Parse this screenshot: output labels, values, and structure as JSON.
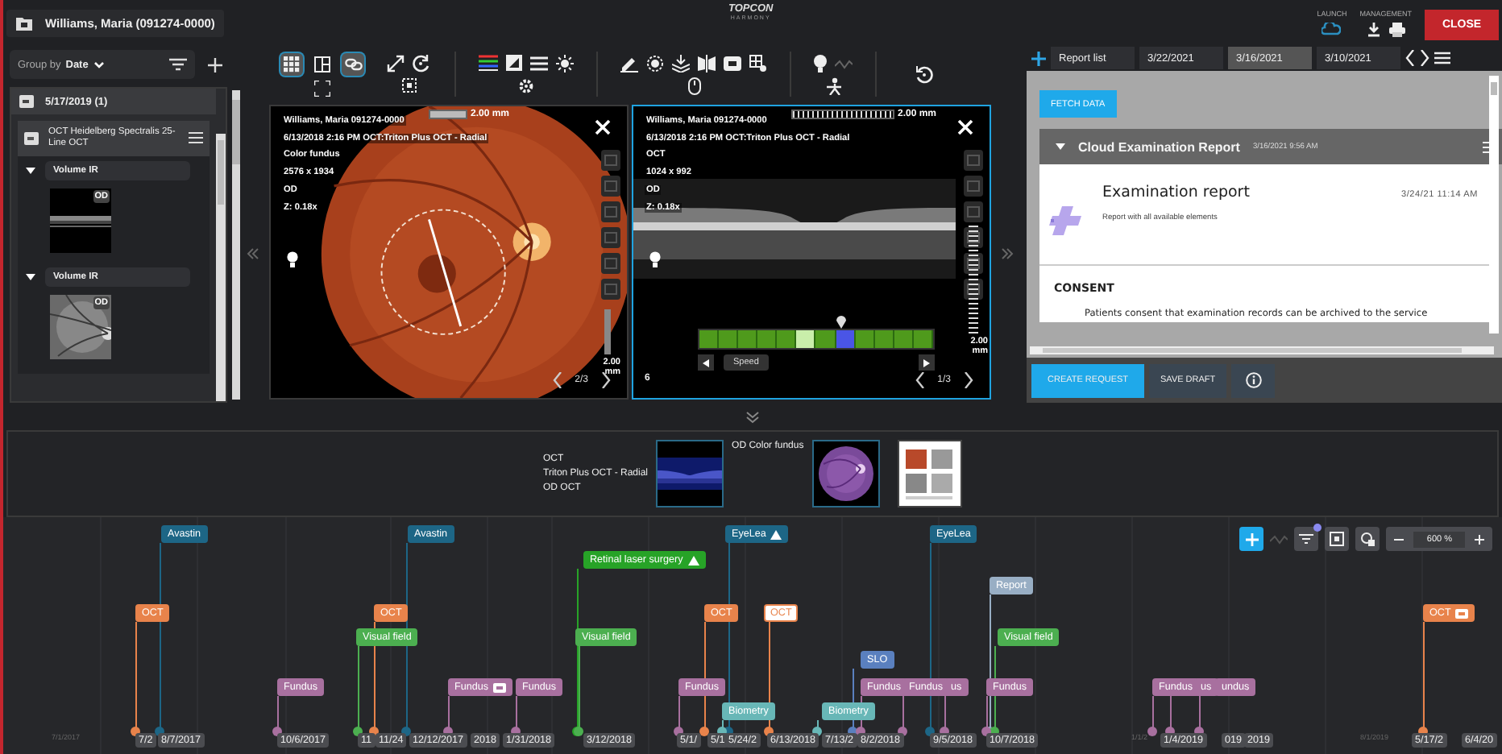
{
  "patient": {
    "name": "Williams, Maria (091274-0000)"
  },
  "brand": {
    "name": "TOPCON",
    "sub": "HARMONY"
  },
  "top_actions": [
    {
      "label": "LAUNCH"
    },
    {
      "label": "MANAGEMENT"
    }
  ],
  "close_button": "CLOSE",
  "sidebar": {
    "group_by_label": "Group by",
    "group_by_value": "Date",
    "groups": [
      {
        "date": "5/17/2019 (1)",
        "items": [
          {
            "title": "OCT Heidelberg Spectralis 25-Line OCT",
            "series": [
              {
                "name": "Volume IR",
                "expanded": true,
                "eye": "OD",
                "kind": "bscan"
              },
              {
                "name": "Volume IR",
                "expanded": true,
                "eye": "OD",
                "kind": "fundus"
              }
            ]
          }
        ]
      }
    ]
  },
  "toolbar": {
    "view_modes": [
      {
        "selected": true
      },
      {
        "selected": false
      },
      {
        "selected": true
      }
    ]
  },
  "viewers": [
    {
      "kind": "fundus",
      "selected": false,
      "scale": "2.00 mm",
      "side_scale": "2.00 mm",
      "info": [
        "Williams, Maria 091274-0000",
        "6/13/2018 2:16 PM OCT:Triton Plus OCT - Radial",
        "Color fundus",
        "2576 x 1934",
        "OD",
        "Z: 0.18x"
      ],
      "page": "2/3"
    },
    {
      "kind": "oct",
      "selected": true,
      "scale": "2.00 mm",
      "side_scale": "2.00 mm",
      "info": [
        "Williams, Maria 091274-0000",
        "6/13/2018 2:16 PM OCT:Triton Plus OCT - Radial",
        "OCT",
        "1024 x 992",
        "OD",
        "Z: 0.18x"
      ],
      "page": "1/3",
      "index": "6",
      "speed_label": "Speed",
      "slices": [
        {
          "selected": false,
          "marked": false
        },
        {
          "selected": false,
          "marked": false
        },
        {
          "selected": false,
          "marked": false
        },
        {
          "selected": false,
          "marked": false
        },
        {
          "selected": false,
          "marked": false
        },
        {
          "selected": false,
          "marked": true
        },
        {
          "selected": false,
          "marked": false
        },
        {
          "selected": true,
          "marked": false
        },
        {
          "selected": false,
          "marked": false
        },
        {
          "selected": false,
          "marked": false
        },
        {
          "selected": false,
          "marked": false
        },
        {
          "selected": false,
          "marked": false
        }
      ]
    }
  ],
  "report": {
    "tabs": [
      {
        "label": "Report list",
        "selected": false
      },
      {
        "label": "3/22/2021",
        "selected": false
      },
      {
        "label": "3/16/2021",
        "selected": true
      },
      {
        "label": "3/10/2021",
        "selected": false
      }
    ],
    "fetch_button": "FETCH DATA",
    "section": {
      "title": "Cloud Examination Report",
      "date": "3/16/2021 9:56 AM",
      "expanded": true
    },
    "doc": {
      "title": "Examination report",
      "date": "3/24/21 11:14 AM",
      "subtitle": "Report with all available elements",
      "heading": "CONSENT",
      "text": "Patients consent that examination records can be archived to the service"
    },
    "buttons": [
      {
        "label": "CREATE REQUEST",
        "kind": "primary"
      },
      {
        "label": "SAVE DRAFT",
        "kind": "secondary"
      }
    ]
  },
  "strip": {
    "lines": [
      "OCT",
      "Triton Plus OCT - Radial",
      "OD OCT"
    ],
    "fundus_label": "OD Color fundus"
  },
  "timeline": {
    "zoom": "600 %",
    "axis_ticks": [
      "7/1/2017",
      "1/1/2",
      "8/1/2019"
    ],
    "events": [
      {
        "label": "Avastin",
        "kind": "medication",
        "warning": false,
        "attachment": false,
        "selected": false
      },
      {
        "label": "Avastin",
        "kind": "medication",
        "warning": false,
        "attachment": false,
        "selected": false
      },
      {
        "label": "EyeLea",
        "kind": "medication",
        "warning": true,
        "attachment": false,
        "selected": false
      },
      {
        "label": "EyeLea",
        "kind": "medication",
        "warning": false,
        "attachment": false,
        "selected": false
      },
      {
        "label": "Retinal laser surgery",
        "kind": "procedure",
        "warning": true,
        "attachment": false,
        "selected": false
      },
      {
        "label": "Report",
        "kind": "report",
        "warning": false,
        "attachment": false,
        "selected": false
      },
      {
        "label": "OCT",
        "kind": "oct",
        "warning": false,
        "attachment": false,
        "selected": false
      },
      {
        "label": "OCT",
        "kind": "oct",
        "warning": false,
        "attachment": false,
        "selected": false
      },
      {
        "label": "OCT",
        "kind": "oct",
        "warning": false,
        "attachment": false,
        "selected": false
      },
      {
        "label": "OCT",
        "kind": "oct",
        "warning": false,
        "attachment": false,
        "selected": true
      },
      {
        "label": "OCT",
        "kind": "oct",
        "warning": false,
        "attachment": true,
        "selected": false
      },
      {
        "label": "Visual field",
        "kind": "visual-field",
        "warning": false,
        "attachment": false,
        "selected": false
      },
      {
        "label": "Visual field",
        "kind": "visual-field",
        "warning": false,
        "attachment": false,
        "selected": false
      },
      {
        "label": "Visual field",
        "kind": "visual-field",
        "warning": false,
        "attachment": false,
        "selected": false
      },
      {
        "label": "SLO",
        "kind": "slo",
        "warning": false,
        "attachment": false,
        "selected": false
      },
      {
        "label": "Fundus",
        "kind": "fundus",
        "warning": false,
        "attachment": false,
        "selected": false
      },
      {
        "label": "Fundus",
        "kind": "fundus",
        "warning": false,
        "attachment": true,
        "selected": false
      },
      {
        "label": "Fundus",
        "kind": "fundus",
        "warning": false,
        "attachment": false,
        "selected": false
      },
      {
        "label": "Fundus",
        "kind": "fundus",
        "warning": false,
        "attachment": false,
        "selected": false
      },
      {
        "label": "Fundus",
        "kind": "fundus",
        "warning": false,
        "attachment": false,
        "selected": false
      },
      {
        "label": "Fundus",
        "kind": "fundus",
        "warning": false,
        "attachment": false,
        "selected": false
      },
      {
        "label": "us",
        "kind": "fundus",
        "warning": false,
        "attachment": false,
        "selected": false
      },
      {
        "label": "Fundus",
        "kind": "fundus",
        "warning": false,
        "attachment": false,
        "selected": false
      },
      {
        "label": "Fundus",
        "kind": "fundus",
        "warning": false,
        "attachment": false,
        "selected": false
      },
      {
        "label": "us",
        "kind": "fundus",
        "warning": false,
        "attachment": false,
        "selected": false
      },
      {
        "label": "undus",
        "kind": "fundus",
        "warning": false,
        "attachment": false,
        "selected": false
      },
      {
        "label": "Biometry",
        "kind": "biometry",
        "warning": false,
        "attachment": false,
        "selected": false
      },
      {
        "label": "Biometry",
        "kind": "biometry",
        "warning": false,
        "attachment": false,
        "selected": false
      }
    ],
    "dates": [
      "7/2",
      "8/7/2017",
      "10/6/2017",
      "11",
      "11/24",
      "12/12/2017",
      "2018",
      "1/31/2018",
      "3/12/2018",
      "5/1/",
      "5/1",
      "5/24/2",
      "6/13/2018",
      "7/13/2",
      "8/2/2018",
      "9/5/2018",
      "10/7/2018",
      "1/4/2019",
      "019",
      "2019",
      "5/17/2",
      "6/4/20"
    ]
  }
}
